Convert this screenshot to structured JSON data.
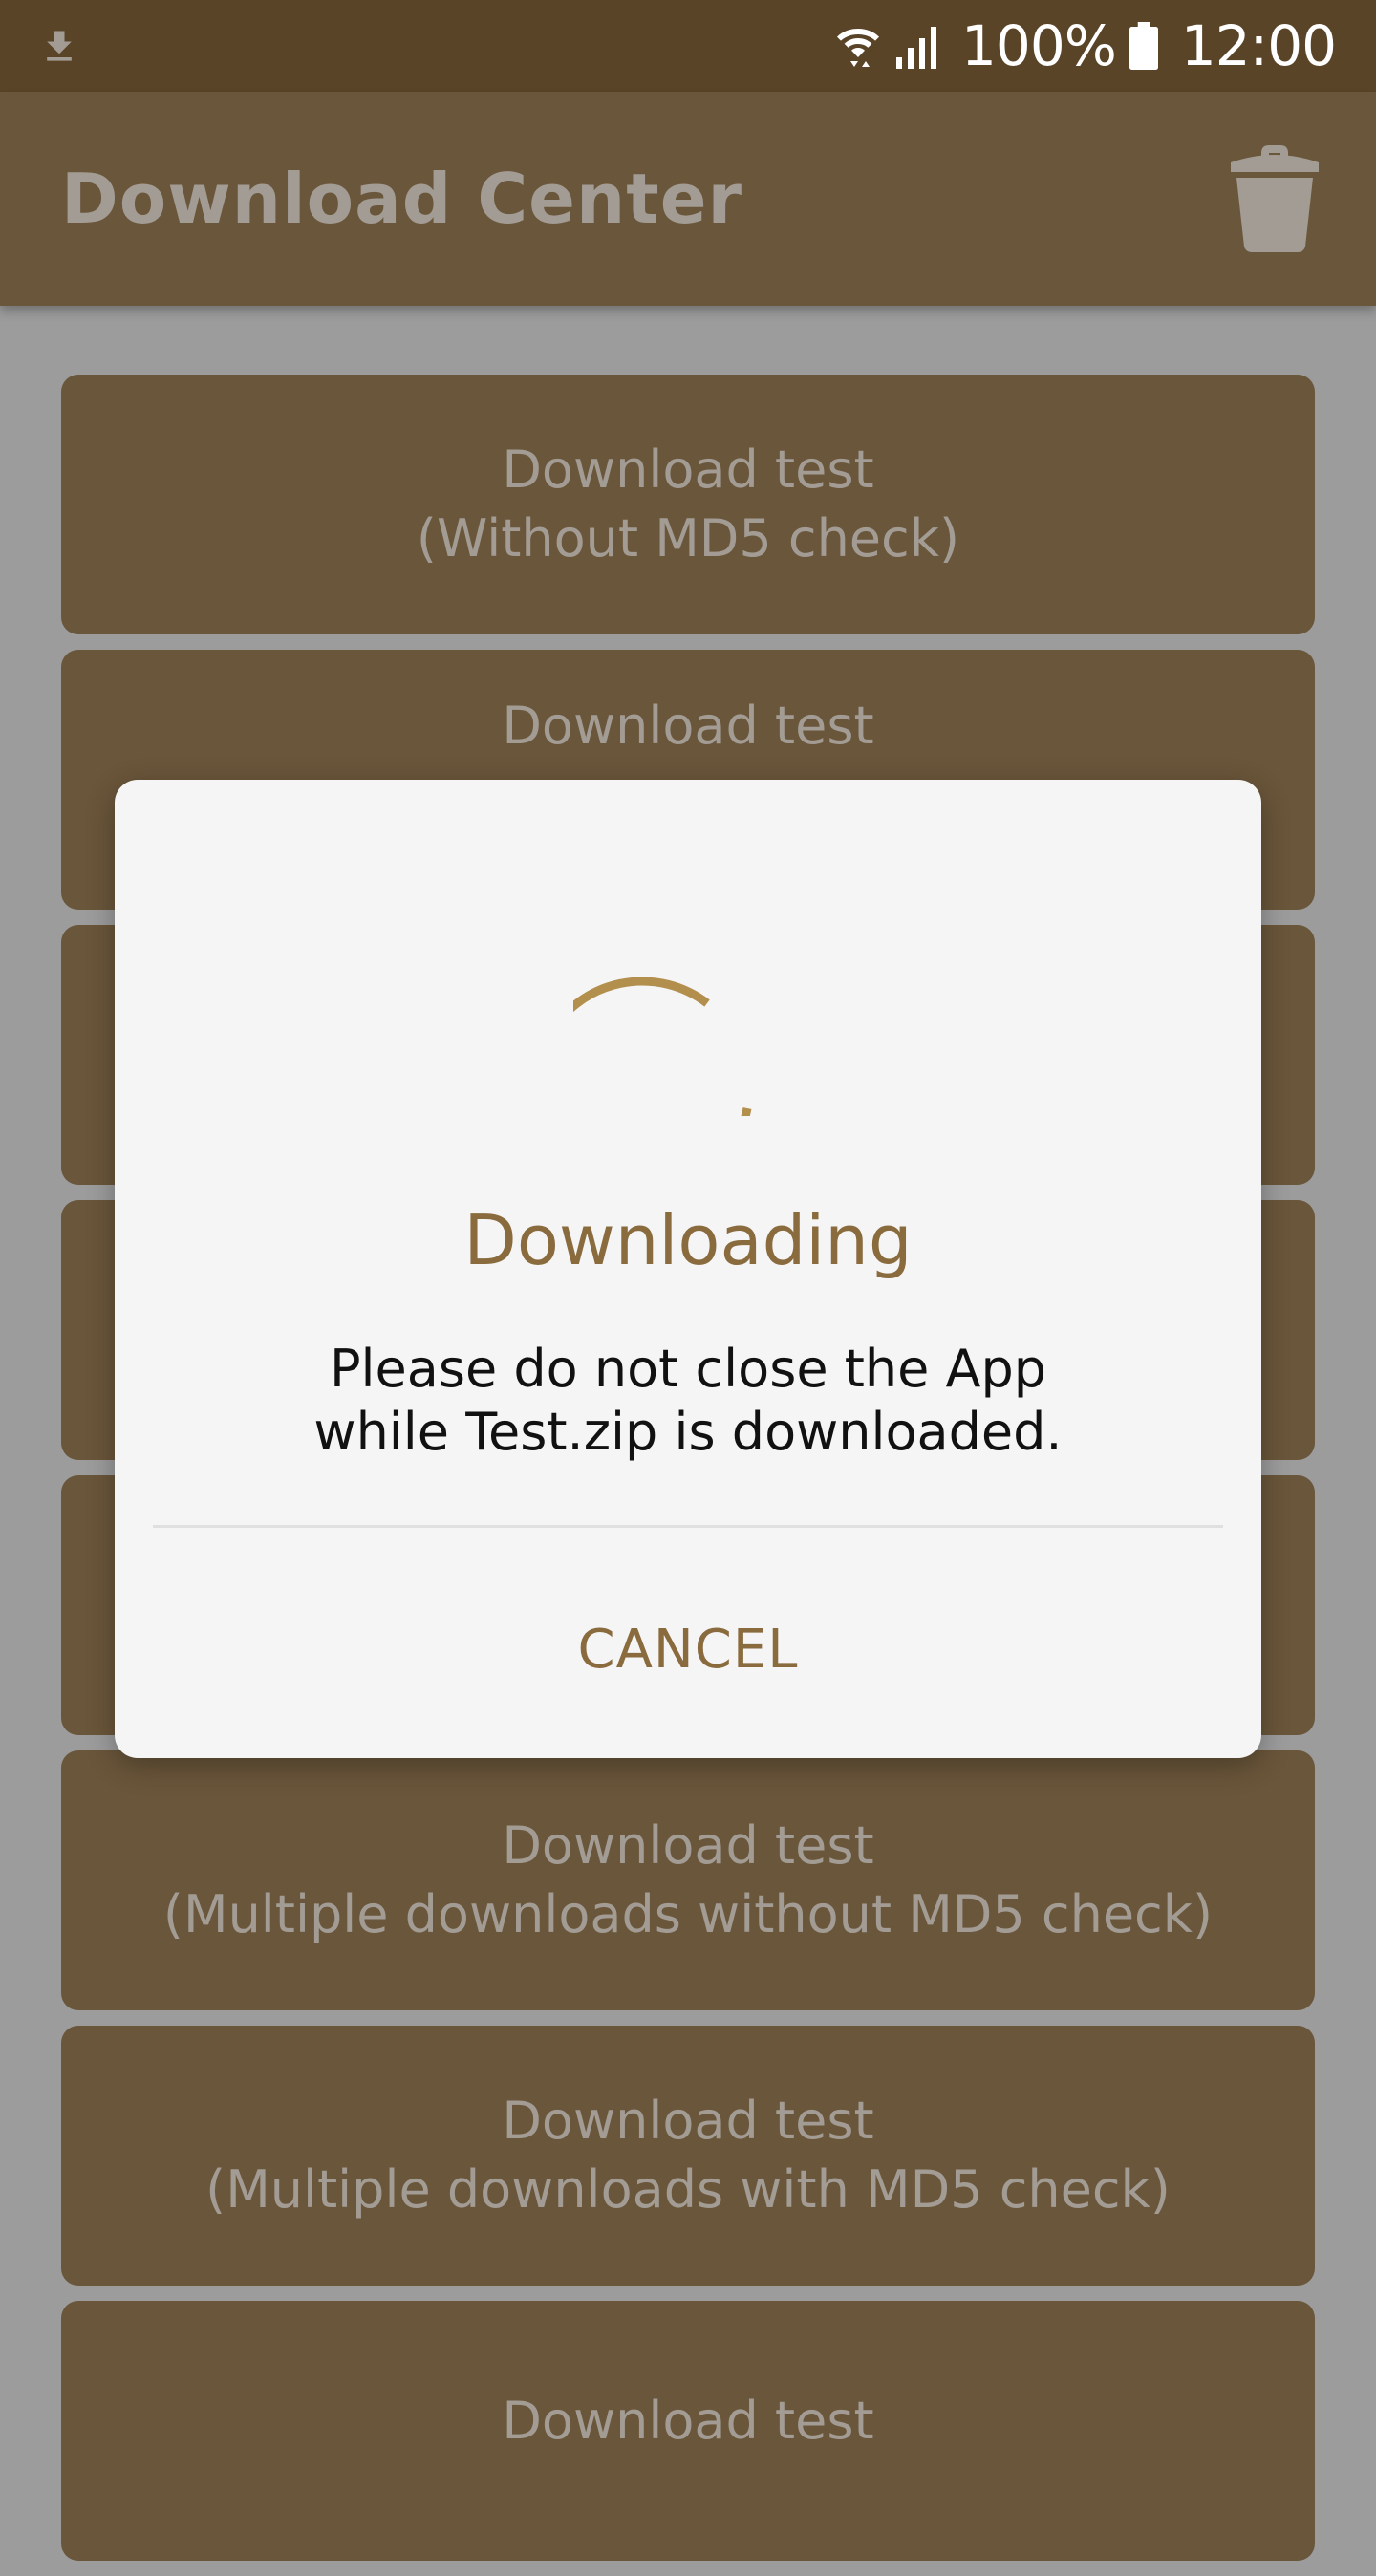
{
  "status_bar": {
    "battery": "100%",
    "time": "12:00",
    "icons": [
      "download-icon",
      "wifi-icon",
      "signal-icon",
      "battery-icon"
    ]
  },
  "app_bar": {
    "title": "Download Center",
    "action_icon": "trash-icon"
  },
  "buttons": [
    {
      "line1": "Download test",
      "line2": "(Without MD5 check)"
    },
    {
      "line1": "Download test",
      "line2": ""
    },
    {
      "line1": "",
      "line2": ""
    },
    {
      "line1": "",
      "line2": ""
    },
    {
      "line1": "",
      "line2": ""
    },
    {
      "line1": "Download test",
      "line2": "(Multiple downloads without MD5 check)"
    },
    {
      "line1": "Download test",
      "line2": "(Multiple downloads with MD5 check)"
    },
    {
      "line1": "Download test",
      "line2": ""
    }
  ],
  "dialog": {
    "title": "Downloading",
    "message_line1": "Please do not close the App",
    "message_line2": "while Test.zip is downloaded.",
    "cancel_label": "CANCEL"
  },
  "colors": {
    "status_bar": "#5a4428",
    "app_bar": "#6a563a",
    "button": "#6a563a",
    "button_text": "#a39c94",
    "accent": "#b38f4e",
    "dialog_title": "#8a6b3e",
    "dim_background": "#9c9c9c"
  }
}
